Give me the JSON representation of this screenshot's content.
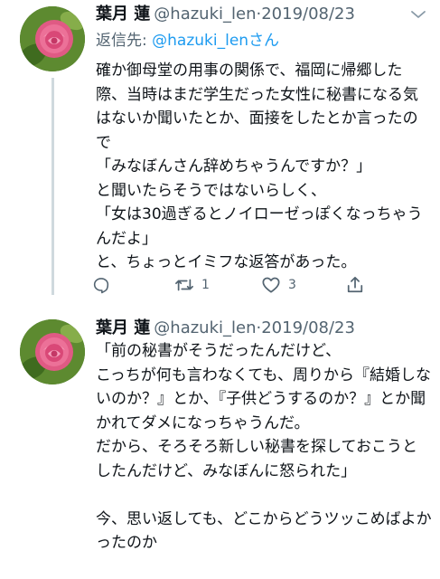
{
  "tweets": [
    {
      "display_name": "葉月 蓮",
      "handle": "@hazuki_len",
      "separator": "·",
      "date": "2019/08/23",
      "reply_prefix": "返信先: ",
      "reply_mention": "@hazuki_len",
      "reply_suffix": "さん",
      "text": "確か御母堂の用事の関係で、福岡に帰郷した際、当時はまだ学生だった女性に秘書になる気はないか聞いたとか、面接をしたとか言ったので\n「みなぼんさん辞めちゃうんですか？」\nと聞いたらそうではないらしく、\n「女は30過ぎるとノイローゼっぽくなっちゃうんだよ」\nと、ちょっとイミフな返答があった。",
      "reply_count": "",
      "retweet_count": "1",
      "like_count": "3",
      "avatar_icon": "rose-avatar-icon"
    },
    {
      "display_name": "葉月 蓮",
      "handle": "@hazuki_len",
      "separator": "·",
      "date": "2019/08/23",
      "text": "「前の秘書がそうだったんだけど、\nこっちが何も言わなくても、周りから『結婚しないのか？』とか、『子供どうするのか？』とか聞かれてダメになっちゃうんだ。\nだから、そろそろ新しい秘書を探しておこうとしたんだけど、みなぼんに怒られた」\n\n今、思い返しても、どこからどうツッこめばよかったのか",
      "avatar_icon": "rose-avatar-icon"
    }
  ],
  "colors": {
    "text": "#0f1419",
    "secondary": "#536471",
    "link": "#1d9bf0",
    "thread_line": "#cfd9de"
  }
}
